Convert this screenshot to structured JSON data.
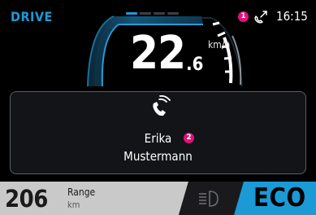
{
  "header": {
    "mode": "DRIVE",
    "clock": "16:15",
    "pages_total": 4,
    "page_active": 1
  },
  "speedometer": {
    "speed_int": "22",
    "speed_dec": ".6",
    "unit": "km/h"
  },
  "call": {
    "first_name": "Erika",
    "last_name": "Mustermann",
    "icon": "incoming-call-icon"
  },
  "markers": {
    "m1": "1",
    "m2": "2"
  },
  "range": {
    "value": "206",
    "label": "Range",
    "unit": "km"
  },
  "drive_mode": "ECO",
  "colors": {
    "accent": "#1b9ad6",
    "marker": "#e0127c",
    "range_bg": "#c9c9c9",
    "eco_bg": "#1b9ad6"
  }
}
